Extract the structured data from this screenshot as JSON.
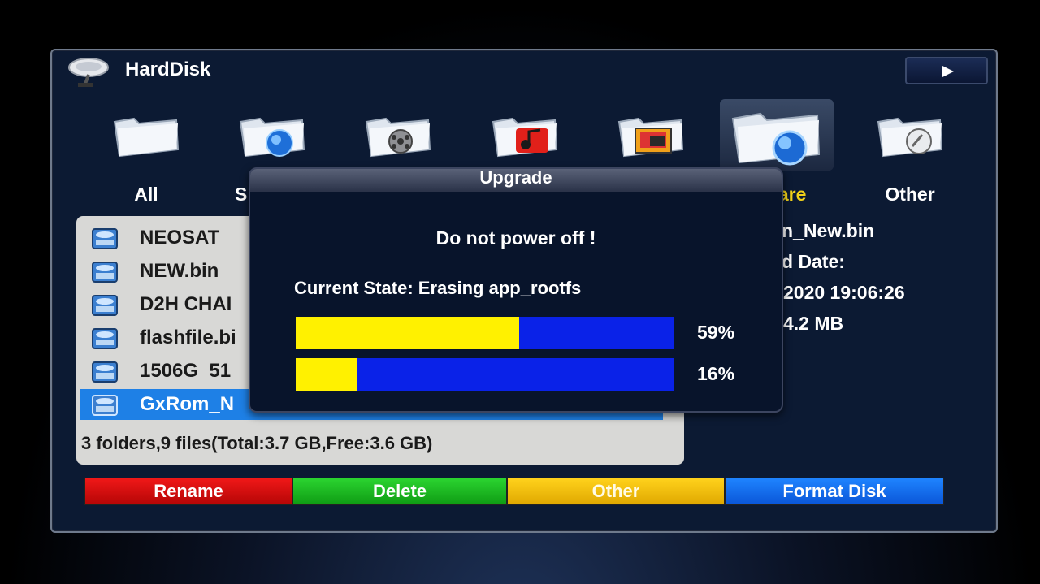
{
  "window": {
    "title": "HardDisk"
  },
  "categories": [
    {
      "label": "All",
      "icon": "folder-plain-icon"
    },
    {
      "label": "S",
      "icon": "folder-globe-icon"
    },
    {
      "label": "",
      "icon": "folder-film-icon"
    },
    {
      "label": "",
      "icon": "folder-music-icon"
    },
    {
      "label": "",
      "icon": "folder-photo-icon"
    },
    {
      "label": "ware",
      "icon": "folder-globe-icon",
      "selected": true
    },
    {
      "label": "Other",
      "icon": "folder-other-icon"
    }
  ],
  "files": [
    {
      "name": "NEOSAT"
    },
    {
      "name": "NEW.bin"
    },
    {
      "name": "D2H CHAI"
    },
    {
      "name": "flashfile.bi"
    },
    {
      "name": "1506G_51"
    },
    {
      "name": "GxRom_N",
      "selected": true
    }
  ],
  "file_summary": "3 folders,9 files(Total:3.7 GB,Free:3.6 GB)",
  "info": {
    "name": "n_New.bin",
    "date_label": "d Date:",
    "date_value": "2020 19:06:26",
    "size": "4.2 MB"
  },
  "buttons": {
    "red": "Rename",
    "green": "Delete",
    "yellow": "Other",
    "blue": "Format Disk"
  },
  "dialog": {
    "title": "Upgrade",
    "warning": "Do not power off !",
    "state": "Current State: Erasing app_rootfs",
    "progress": [
      {
        "label": "59%",
        "value": 0.59
      },
      {
        "label": "16%",
        "value": 0.16
      }
    ]
  },
  "colors": {
    "progress_fill": "#fff100",
    "progress_track": "#0a22e8",
    "selection": "#1e80e6",
    "active_label": "#f2d21a"
  }
}
